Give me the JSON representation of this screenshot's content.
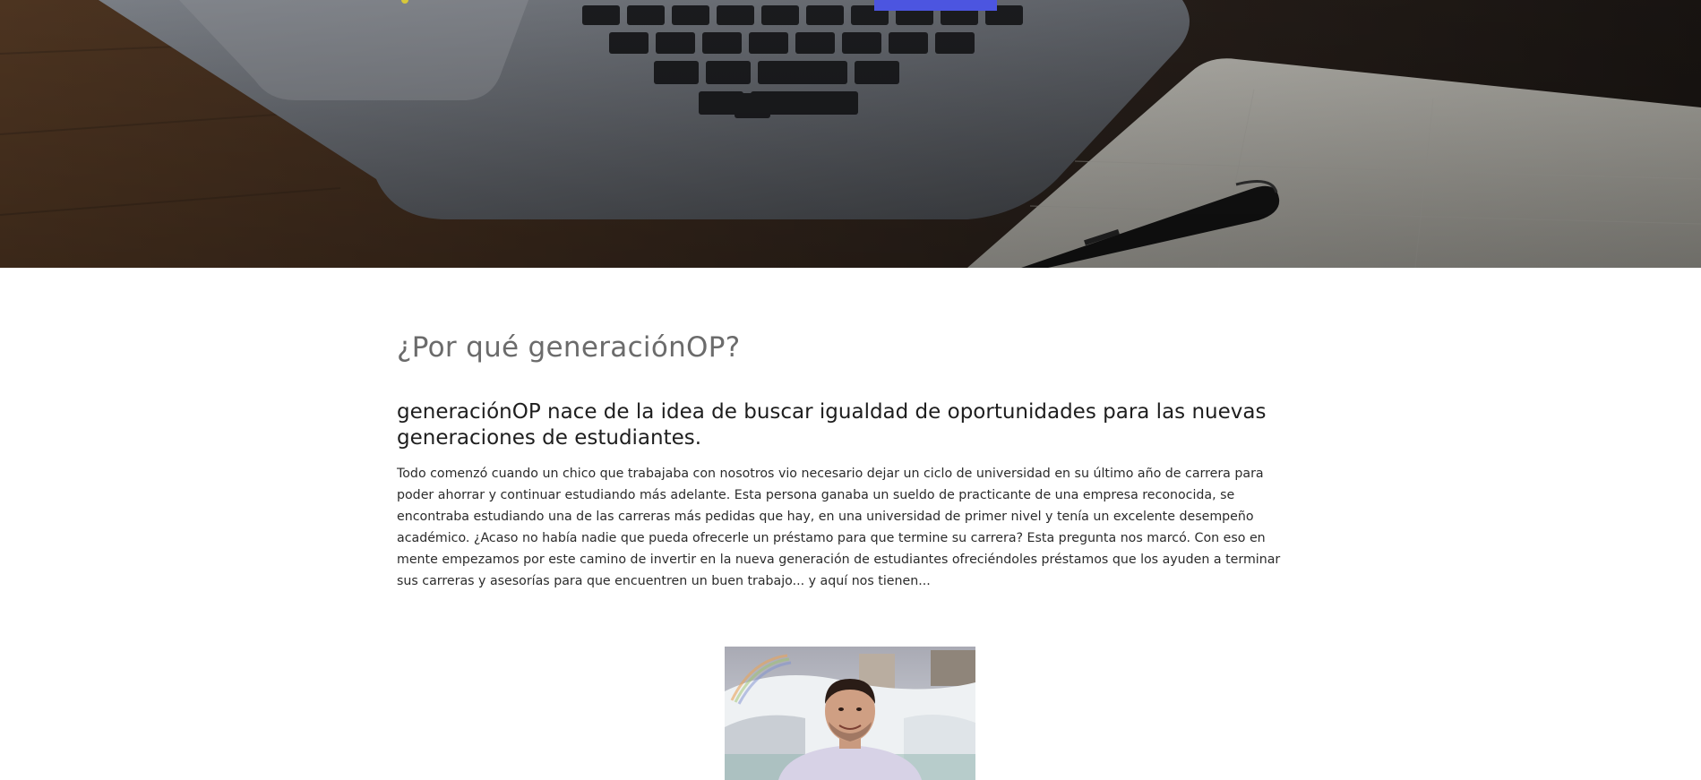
{
  "hero": {
    "image": "laptop-notebook-pen-photo"
  },
  "about": {
    "title": "¿Por qué generaciónOP?",
    "lead": "generaciónOP nace de la idea de buscar igualdad de oportunidades para las nuevas generaciones de estudiantes.",
    "body": "Todo comenzó cuando un chico que trabajaba con nosotros vio necesario dejar un ciclo de universidad en su último año de carrera para poder ahorrar y continuar estudiando más adelante. Esta persona ganaba un sueldo de practicante de una empresa reconocida, se encontraba estudiando una de las carreras más pedidas que hay, en una universidad de primer nivel y tenía un excelente desempeño académico. ¿Acaso no había nadie que pueda ofrecerle un préstamo para que termine su carrera? Esta pregunta nos marcó. Con eso en mente empezamos por este camino de invertir en la nueva generación de estudiantes ofreciéndoles préstamos que los ayuden a terminar sus carreras y asesorías para que encuentren un buen trabajo... y aquí nos tienen..."
  },
  "portrait": {
    "image": "founder-photo-waterfall"
  },
  "colors": {
    "accent": "#4c55e0",
    "title": "#6b6b6b",
    "text": "#1e1e1e"
  }
}
